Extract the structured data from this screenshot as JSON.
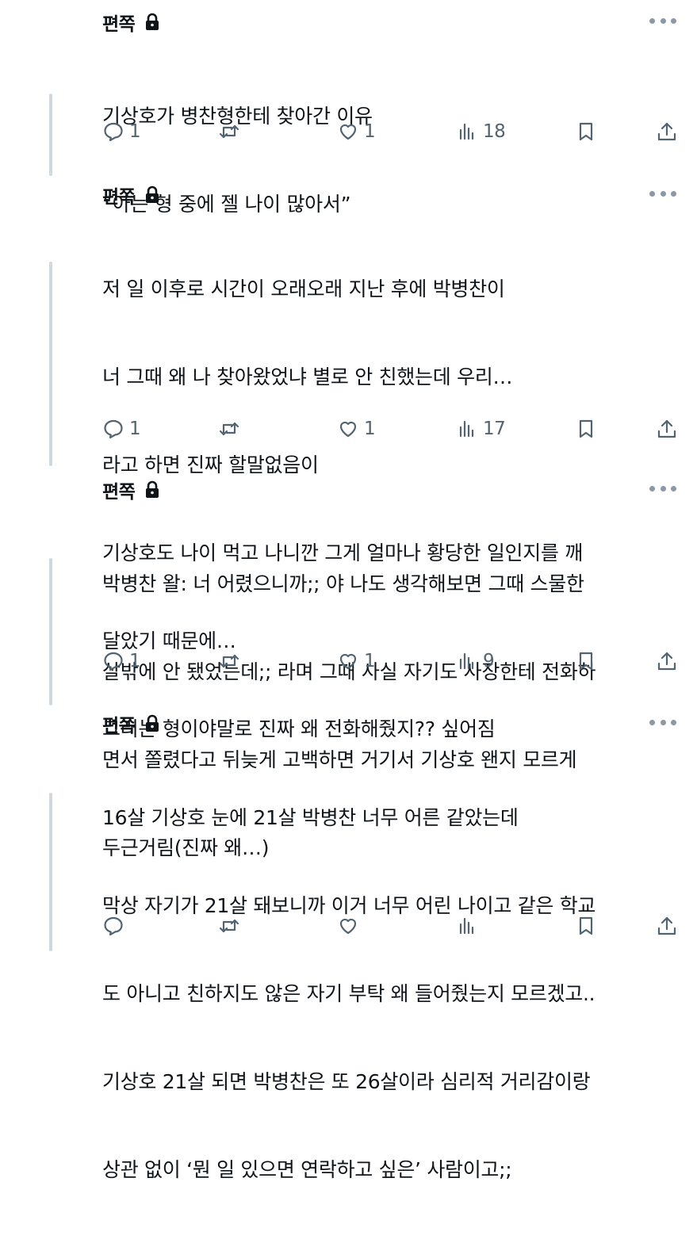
{
  "tweets": [
    {
      "author": "편쪽",
      "lines": [
        "기상호가 병찬형한테 찾아간 이유",
        "“아는 형 중에 젤 나이 많아서”"
      ],
      "replies": "1",
      "retweets": "",
      "likes": "1",
      "views": "18"
    },
    {
      "author": "편쪽",
      "lines": [
        "저 일 이후로 시간이 오래오래 지난 후에 박병찬이",
        "너 그때 왜 나 찾아왔었냐 별로 안 친했는데 우리…",
        "라고 하면 진짜 할말없음이",
        "기상호도 나이 먹고 나니깐 그게 얼마나 황당한 일인지를 깨",
        "달았기 때문에…",
        "그러는 형이야말로 진짜 왜 전화해줬지?? 싶어짐"
      ],
      "replies": "1",
      "retweets": "",
      "likes": "1",
      "views": "17"
    },
    {
      "author": "편쪽",
      "lines": [
        "박병찬 왈: 너 어렸으니까;; 야 나도 생각해보면 그때 스물한",
        "살밖에 안 됐었는데;; 라며 그때 사실 자기도 사장한테 전화하",
        "면서 쫄렸다고 뒤늦게 고백하면 거기서 기상호 왠지 모르게",
        "두근거림(진짜 왜…)"
      ],
      "replies": "1",
      "retweets": "",
      "likes": "1",
      "views": "9"
    },
    {
      "author": "편쪽",
      "lines": [
        "16살 기상호 눈에 21살 박병찬 너무 어른 같았는데",
        "막상 자기가 21살 돼보니까 이거 너무 어린 나이고 같은 학교",
        "도 아니고 친하지도 않은 자기 부탁 왜 들어줬는지 모르겠고..",
        "기상호 21살 되면 박병찬은 또 26살이라 심리적 거리감이랑",
        "상관 없이 ‘뭔 일 있으면 연락하고 싶은’ 사람이고;;"
      ],
      "replies": "",
      "retweets": "",
      "likes": "",
      "views": ""
    }
  ],
  "icons": {
    "reply": "reply-icon",
    "retweet": "retweet-icon",
    "like": "heart-icon",
    "views": "views-icon",
    "bookmark": "bookmark-icon",
    "share": "share-icon",
    "lock": "lock-icon",
    "more": "more-icon"
  },
  "colors": {
    "text": "#0f1419",
    "muted": "#536471",
    "thread_line": "#cfd9de"
  }
}
